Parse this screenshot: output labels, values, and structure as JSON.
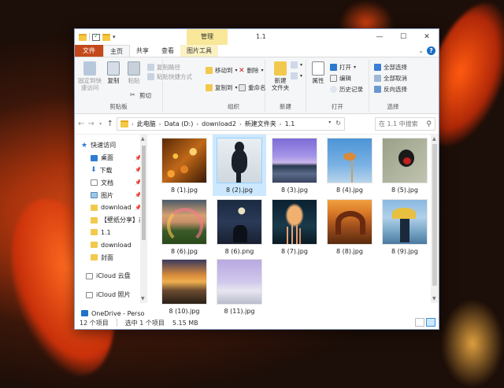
{
  "window": {
    "title": "1.1",
    "manage_tab": "管理",
    "controls": {
      "minimize": "—",
      "maximize": "☐",
      "close": "✕"
    }
  },
  "ribbon_tabs": [
    "文件",
    "主页",
    "共享",
    "查看",
    "图片工具"
  ],
  "ribbon": {
    "clipboard": {
      "pin_label_1": "固定到快",
      "pin_label_2": "速访问",
      "copy": "复制",
      "paste": "粘贴",
      "copy_path": "复制路径",
      "paste_shortcut": "粘贴快捷方式",
      "cut": "剪切",
      "group": "剪贴板"
    },
    "organize": {
      "move_to": "移动到",
      "copy_to": "复制到",
      "delete": "删除",
      "rename": "重命名",
      "group": "组织"
    },
    "new": {
      "new_folder_1": "新建",
      "new_folder_2": "文件夹",
      "group": "新建"
    },
    "open": {
      "properties": "属性",
      "open": "打开",
      "edit": "编辑",
      "history": "历史记录",
      "group": "打开"
    },
    "select": {
      "select_all": "全部选择",
      "select_none": "全部取消",
      "invert": "反向选择",
      "group": "选择"
    }
  },
  "address": {
    "crumbs": [
      "此电脑",
      "Data (D:)",
      "download2",
      "新建文件夹",
      "1.1"
    ],
    "search_placeholder": "在 1.1 中搜索"
  },
  "nav": {
    "quick_access": "快速访问",
    "items": [
      "桌面",
      "下载",
      "文档",
      "图片",
      "download",
      "【壁纸分享】高",
      "1.1",
      "download",
      "封面"
    ],
    "icloud_drive": "iCloud 云盘",
    "icloud_photos": "iCloud 照片",
    "onedrive": "OneDrive - Perso"
  },
  "files": [
    "8 (1).jpg",
    "8 (2).jpg",
    "8 (3).jpg",
    "8 (4).jpg",
    "8 (5).jpg",
    "8 (6).jpg",
    "8 (6).png",
    "8 (7).jpg",
    "8 (8).jpg",
    "8 (9).jpg",
    "8 (10).jpg",
    "8 (11).jpg"
  ],
  "status": {
    "count": "12 个项目",
    "selected": "选中 1 个项目",
    "size": "5.15 MB"
  }
}
